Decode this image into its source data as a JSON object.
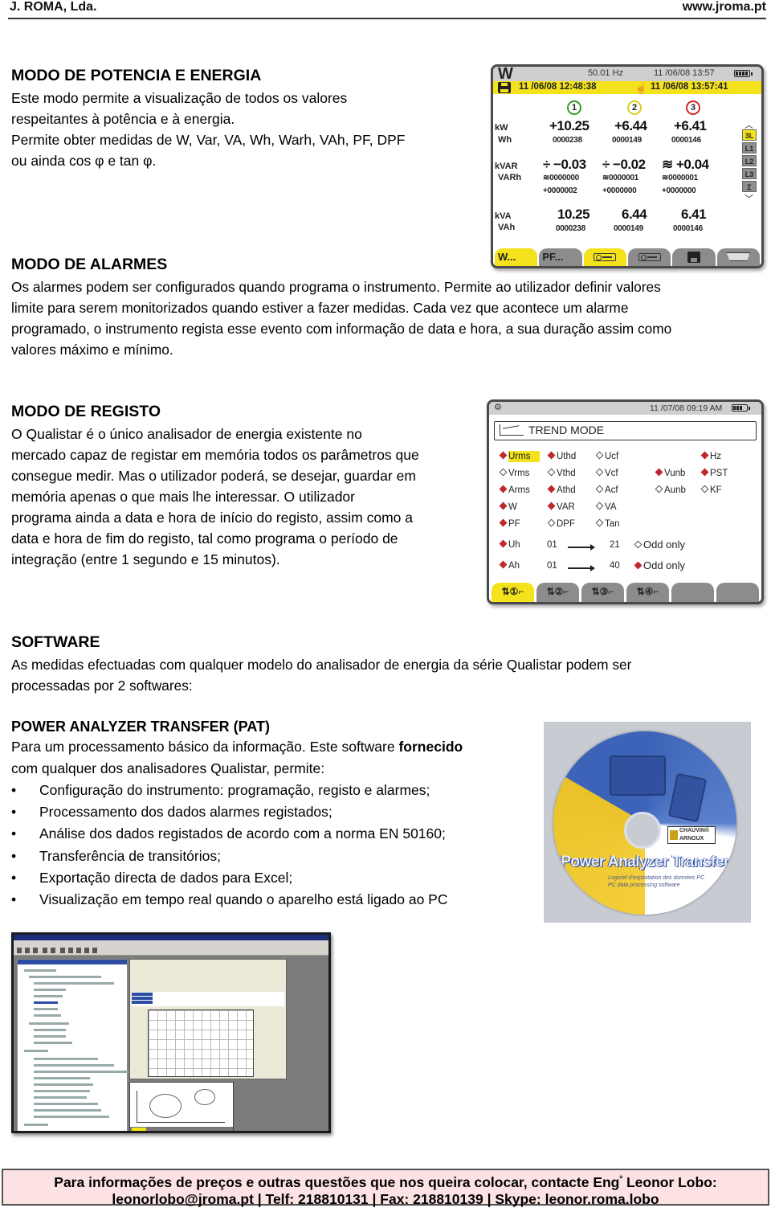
{
  "header": {
    "company": "J. ROMA, Lda.",
    "website": "www.jroma.pt"
  },
  "sections": {
    "power": {
      "title": "MODO DE POTENCIA E ENERGIA",
      "lines": [
        "Este modo permite a visualização de todos os valores",
        "respeitantes à potência e à energia.",
        "Permite obter medidas de W, Var, VA, Wh, Warh, VAh, PF, DPF",
        "ou ainda cos φ e tan φ."
      ]
    },
    "alarms": {
      "title": "MODO DE ALARMES",
      "lines": [
        "Os alarmes podem ser configurados quando programa o instrumento. Permite ao utilizador definir valores",
        "limite para serem monitorizados quando estiver a fazer medidas. Cada vez que acontece um alarme",
        "programado, o instrumento regista esse evento com informação de data e hora, a sua duração assim como",
        "valores máximo e mínimo."
      ]
    },
    "registo": {
      "title": "MODO DE REGISTO",
      "lines": [
        "O Qualistar é o único analisador de energia existente no",
        "mercado capaz de registar em memória todos os parâmetros que",
        "consegue medir. Mas o utilizador poderá, se desejar, guardar em",
        "memória apenas o que mais lhe interessar. O utilizador",
        "programa ainda a data e hora de início do registo, assim como a",
        "data e hora de fim do registo, tal como programa o período de",
        "integração (entre 1 segundo e 15 minutos)."
      ]
    },
    "software": {
      "title": "SOFTWARE",
      "lines": [
        "As medidas efectuadas com qualquer modelo do analisador de energia da série Qualistar podem ser",
        "processadas por 2 softwares:"
      ]
    },
    "pat": {
      "title": "POWER ANALYZER TRANSFER (PAT)",
      "intro_a": "Para um processamento básico da informação. Este software ",
      "intro_bold": "fornecido",
      "intro_b": "com qualquer dos analisadores Qualistar, permite:",
      "bullets": [
        "Configuração do instrumento: programação, registo e alarmes;",
        "Processamento dos dados alarmes registados;",
        "Análise dos dados registados de acordo com a norma EN 50160;",
        "Transferência de transitórios;",
        "Exportação directa de dados para Excel;",
        "Visualização em tempo real quando o aparelho está ligado ao PC"
      ],
      "bullet_glyph": "•"
    }
  },
  "device_power": {
    "mode_icon": "W",
    "frequency": "50.01 Hz",
    "datetime": "11 /06/08 13:57",
    "record_start": "11 /06/08 12:48:38",
    "record_end": "11 /06/08 13:57:41",
    "hand_icon": "☝",
    "phases": [
      {
        "label": "1",
        "color": "#3a9a2c"
      },
      {
        "label": "2",
        "color": "#d9cf1a"
      },
      {
        "label": "3",
        "color": "#d2262b"
      }
    ],
    "rows": {
      "kw": {
        "label": "kW",
        "sub": "Wh",
        "values": [
          "+10.25",
          "+6.44",
          "+6.41"
        ],
        "energy": [
          "0000238",
          "0000149",
          "0000146"
        ]
      },
      "kvar": {
        "label": "kVAR",
        "sub": "VARh",
        "values": [
          "÷ −0.03",
          "÷ −0.02",
          "≋ +0.04"
        ],
        "energy_a": [
          "≋0000000",
          "≋0000001",
          "≋0000001"
        ],
        "energy_b": [
          "+0000002",
          "+0000000",
          "+0000000"
        ]
      },
      "kva": {
        "label": "kVA",
        "sub": "VAh",
        "values": [
          "10.25",
          "6.44",
          "6.41"
        ],
        "energy": [
          "0000238",
          "0000149",
          "0000146"
        ]
      }
    },
    "side_tabs": [
      {
        "label": "3L",
        "active": true
      },
      {
        "label": "L1",
        "active": false
      },
      {
        "label": "L2",
        "active": false
      },
      {
        "label": "L3",
        "active": false
      },
      {
        "label": "Σ",
        "active": false
      }
    ],
    "arrow_up": "︿",
    "arrow_down": "﹀",
    "footer_tabs": [
      {
        "label": "W...",
        "icon": "",
        "active": true
      },
      {
        "label": "PF...",
        "icon": "",
        "active": false
      },
      {
        "label": "",
        "icon": "meter-icon",
        "active": true
      },
      {
        "label": "",
        "icon": "meter-icon",
        "active": false
      },
      {
        "label": "",
        "icon": "save-icon",
        "active": false
      },
      {
        "label": "",
        "icon": "connector-icon",
        "active": false
      }
    ]
  },
  "device_trend": {
    "tools_icon": "⚙",
    "datetime": "11 /07/08 09:19 AM",
    "title": "TREND MODE",
    "options": [
      [
        {
          "label": "Urms",
          "on": true,
          "highlight": true
        },
        {
          "label": "Uthd",
          "on": true
        },
        {
          "label": "Ucf",
          "on": false
        },
        null,
        {
          "label": "Hz",
          "on": true
        }
      ],
      [
        {
          "label": "Vrms",
          "on": false
        },
        {
          "label": "Vthd",
          "on": false
        },
        {
          "label": "Vcf",
          "on": false
        },
        {
          "label": "Vunb",
          "on": true
        },
        {
          "label": "PST",
          "on": true
        }
      ],
      [
        {
          "label": "Arms",
          "on": true
        },
        {
          "label": "Athd",
          "on": true
        },
        {
          "label": "Acf",
          "on": false
        },
        {
          "label": "Aunb",
          "on": false
        },
        {
          "label": "KF",
          "on": false
        }
      ],
      [
        {
          "label": "W",
          "on": true
        },
        {
          "label": "VAR",
          "on": true
        },
        {
          "label": "VA",
          "on": false
        },
        null,
        null
      ],
      [
        {
          "label": "PF",
          "on": true
        },
        {
          "label": "DPF",
          "on": false
        },
        {
          "label": "Tan",
          "on": false
        },
        null,
        null
      ]
    ],
    "harmonics": [
      {
        "label": "Uh",
        "on": true,
        "from": "01",
        "to": "21",
        "odd_label": "Odd only",
        "odd_on": false
      },
      {
        "label": "Ah",
        "on": true,
        "from": "01",
        "to": "40",
        "odd_label": "Odd only",
        "odd_on": true
      }
    ],
    "footer_tabs": [
      {
        "label": "⇅①⌐",
        "active": true
      },
      {
        "label": "⇅②⌐",
        "active": false
      },
      {
        "label": "⇅③⌐",
        "active": false
      },
      {
        "label": "⇅④⌐",
        "active": false
      },
      {
        "label": "",
        "active": false
      },
      {
        "label": "",
        "active": false
      }
    ]
  },
  "cd": {
    "title": "Power Analyzer Transfer",
    "subtitle_fr": "Logiciel d'exploitation des données PC",
    "subtitle_en": "PC data processing software",
    "brand_line1": "CHAUVIN®",
    "brand_line2": "ARNOUX"
  },
  "footer": {
    "line1_a": "Para informações de preços e outras questões que nos queira colocar, contacte Eng",
    "line1_sup": "ª",
    "line1_b": " Leonor Lobo:",
    "email": "leonorlobo@jroma.pt",
    "phone": "Telf: 218810131",
    "fax": "Fax: 218810139",
    "skype": "Skype: leonor.roma.lobo",
    "separator": " | "
  }
}
